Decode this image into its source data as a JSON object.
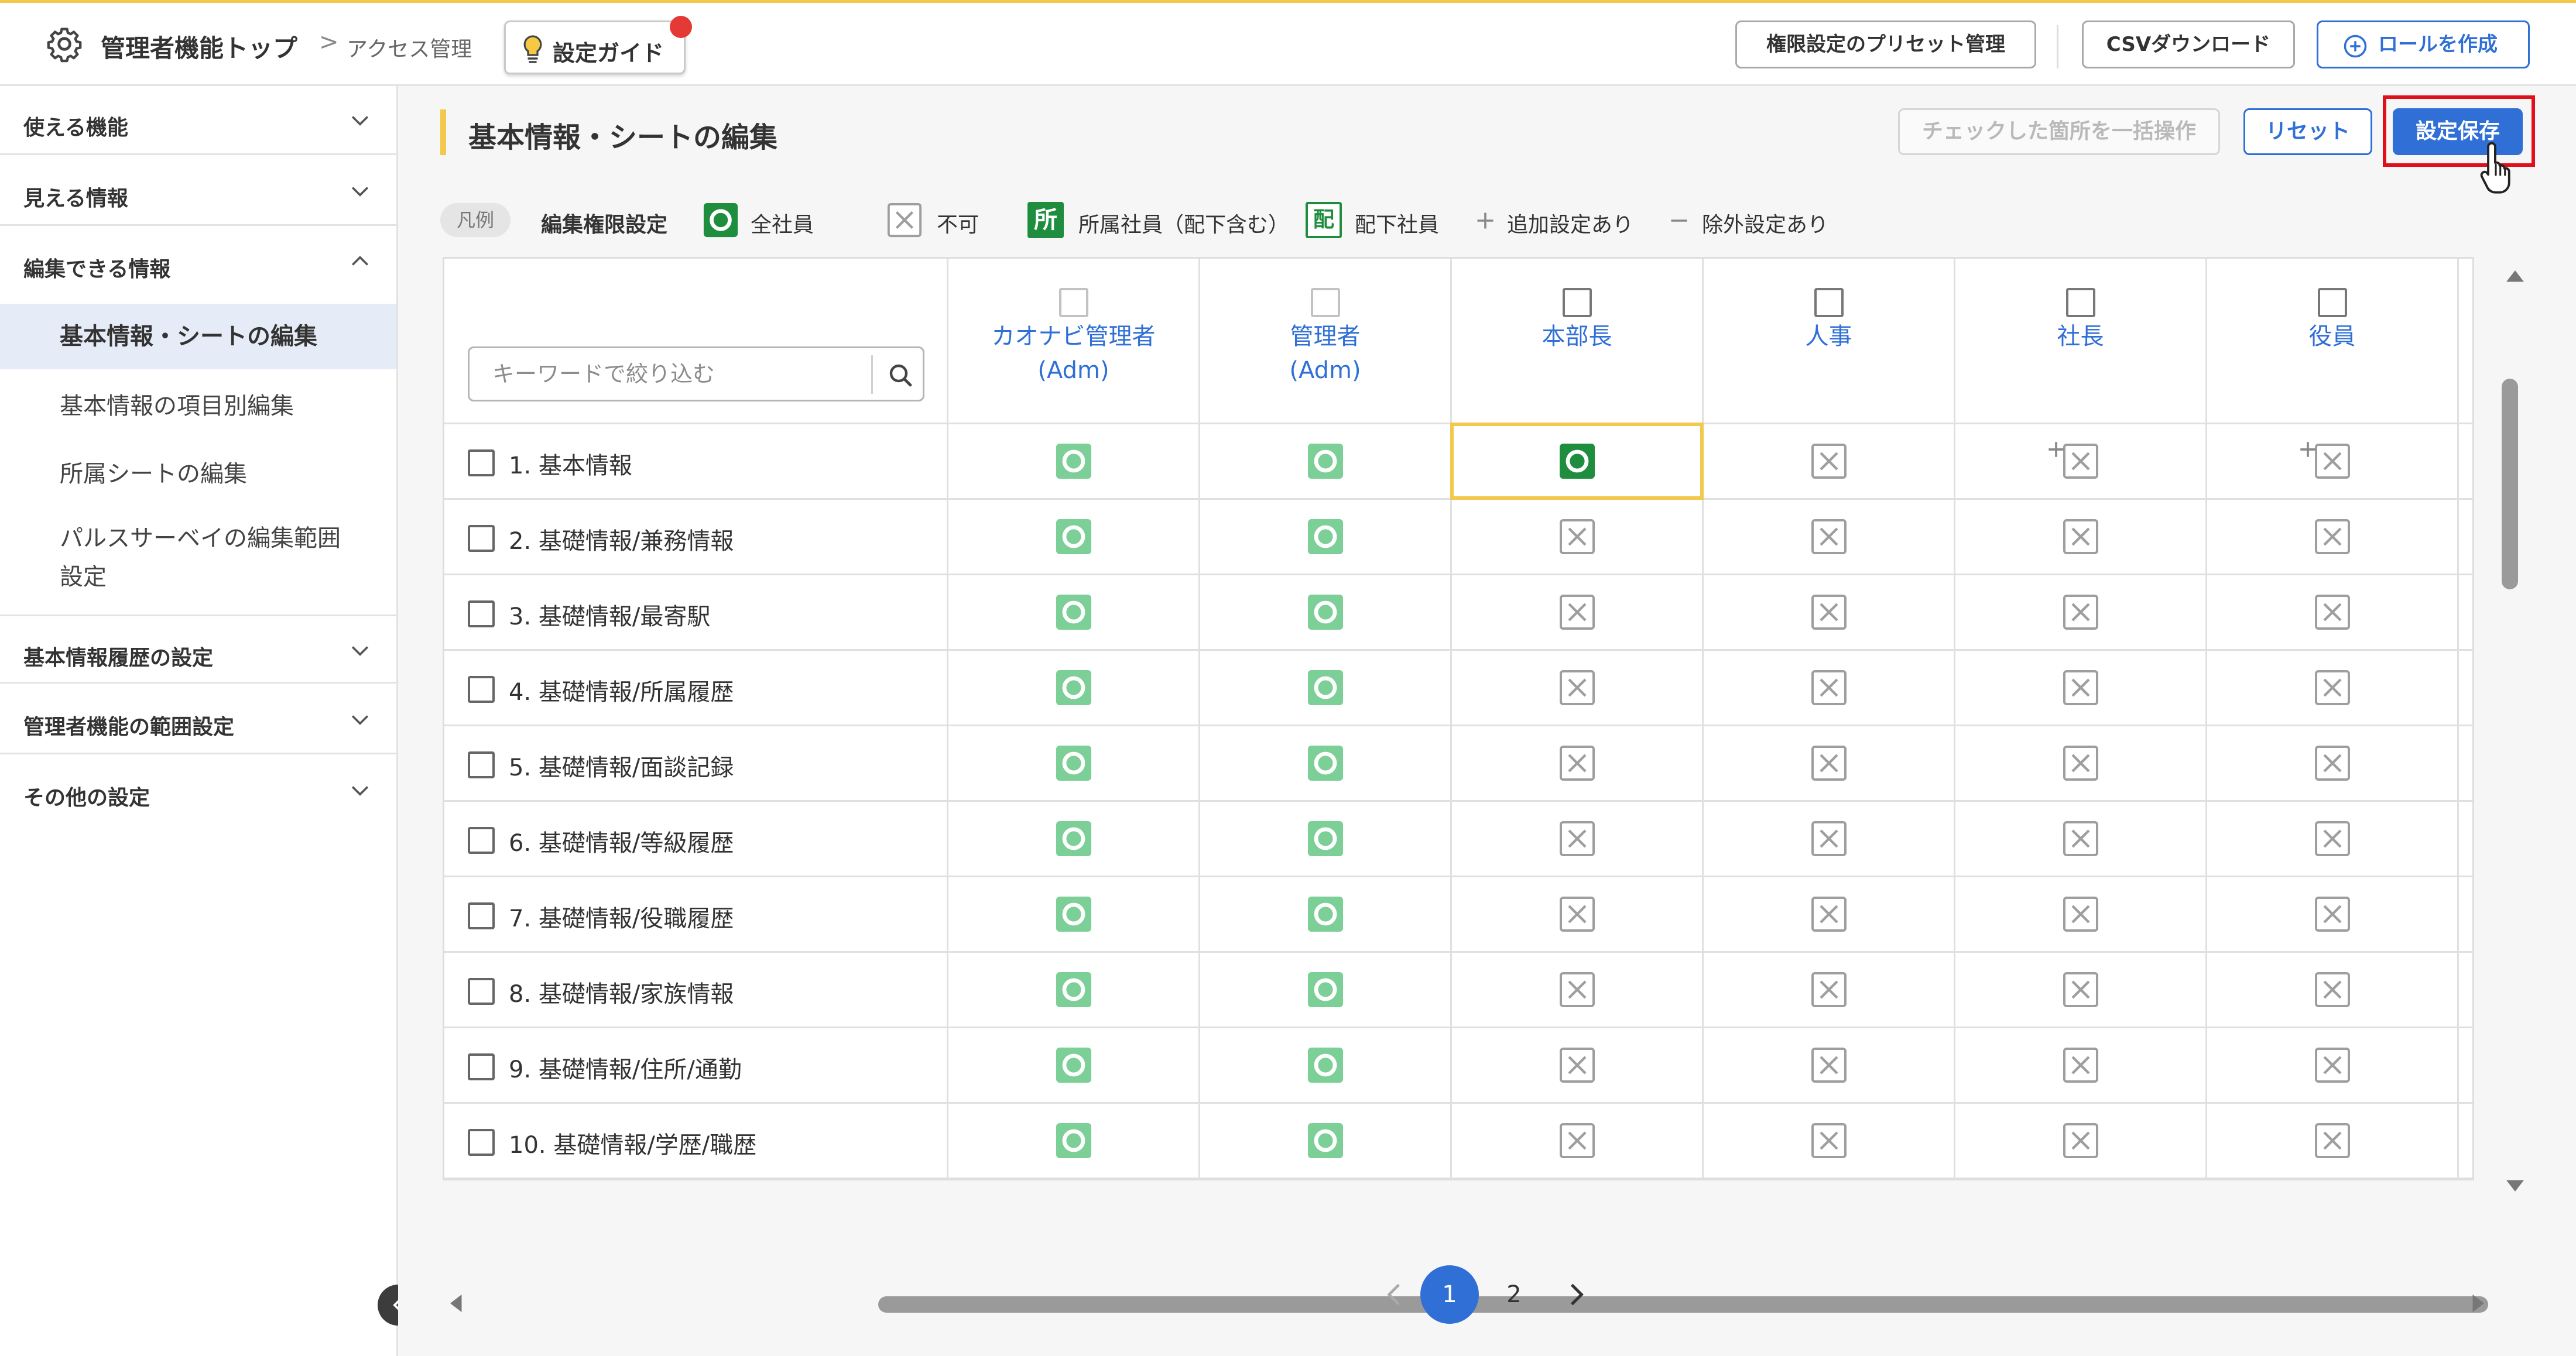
{
  "header": {
    "title": "管理者機能トップ",
    "separator": ">",
    "crumb": "アクセス管理",
    "guide_label": "設定ガイド",
    "preset_button": "権限設定のプリセット管理",
    "csv_button": "CSVダウンロード",
    "create_role_button": "ロールを作成"
  },
  "sidebar": {
    "sections": [
      {
        "label": "使える機能",
        "expanded": false
      },
      {
        "label": "見える情報",
        "expanded": false
      },
      {
        "label": "編集できる情報",
        "expanded": true
      },
      {
        "label": "基本情報履歴の設定",
        "expanded": false
      },
      {
        "label": "管理者機能の範囲設定",
        "expanded": false
      },
      {
        "label": "その他の設定",
        "expanded": false
      }
    ],
    "subitems": [
      {
        "label": "基本情報・シートの編集",
        "active": true
      },
      {
        "label": "基本情報の項目別編集"
      },
      {
        "label": "所属シートの編集"
      },
      {
        "label": "パルスサーベイの編集範囲"
      },
      {
        "label": "設定"
      }
    ]
  },
  "main": {
    "title": "基本情報・シートの編集",
    "bulk_button": "チェックした箇所を一括操作",
    "reset_button": "リセット",
    "save_button": "設定保存",
    "legend": {
      "pill": "凡例",
      "heading": "編集権限設定",
      "all": "全社員",
      "none": "不可",
      "dept_icon": "所",
      "dept": "所属社員（配下含む）",
      "sub_icon": "配",
      "sub": "配下社員",
      "add": "追加設定あり",
      "exclude": "除外設定あり"
    },
    "search_placeholder": "キーワードで絞り込む",
    "columns": [
      {
        "line1": "カオナビ管理者",
        "line2": "(Adm)"
      },
      {
        "line1": "管理者",
        "line2": "(Adm)"
      },
      {
        "line1": "本部長",
        "line2": ""
      },
      {
        "line1": "人事",
        "line2": ""
      },
      {
        "line1": "社長",
        "line2": ""
      },
      {
        "line1": "役員",
        "line2": ""
      }
    ],
    "rows": [
      {
        "label": "1. 基本情報",
        "cells": [
          "all",
          "all",
          "all-active",
          "none",
          "none-plus",
          "none-plus"
        ]
      },
      {
        "label": "2. 基礎情報/兼務情報",
        "cells": [
          "all",
          "all",
          "none",
          "none",
          "none",
          "none"
        ]
      },
      {
        "label": "3. 基礎情報/最寄駅",
        "cells": [
          "all",
          "all",
          "none",
          "none",
          "none",
          "none"
        ]
      },
      {
        "label": "4. 基礎情報/所属履歴",
        "cells": [
          "all",
          "all",
          "none",
          "none",
          "none",
          "none"
        ]
      },
      {
        "label": "5. 基礎情報/面談記録",
        "cells": [
          "all",
          "all",
          "none",
          "none",
          "none",
          "none"
        ]
      },
      {
        "label": "6. 基礎情報/等級履歴",
        "cells": [
          "all",
          "all",
          "none",
          "none",
          "none",
          "none"
        ]
      },
      {
        "label": "7. 基礎情報/役職履歴",
        "cells": [
          "all",
          "all",
          "none",
          "none",
          "none",
          "none"
        ]
      },
      {
        "label": "8. 基礎情報/家族情報",
        "cells": [
          "all",
          "all",
          "none",
          "none",
          "none",
          "none"
        ]
      },
      {
        "label": "9. 基礎情報/住所/通勤",
        "cells": [
          "all",
          "all",
          "none",
          "none",
          "none",
          "none"
        ]
      },
      {
        "label": "10. 基礎情報/学歴/職歴",
        "cells": [
          "all",
          "all",
          "none",
          "none",
          "none",
          "none"
        ]
      }
    ],
    "pagination": {
      "pages": [
        "1",
        "2"
      ],
      "current": "1"
    }
  },
  "colors": {
    "accent": "#2f6fd6",
    "green": "#1e8e3e",
    "green_light": "#7ccf96",
    "highlight": "#f2c94c",
    "alert": "#e0101a"
  }
}
